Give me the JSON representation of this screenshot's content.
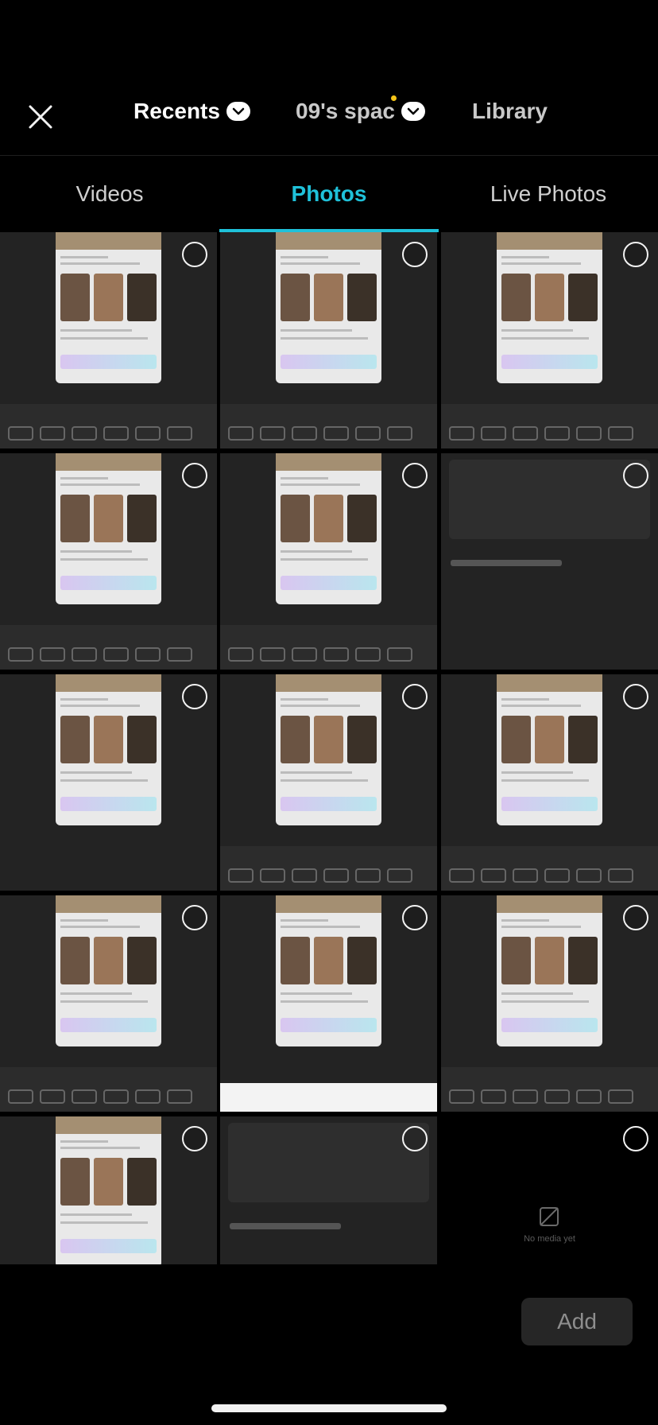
{
  "header": {
    "close_icon": "close-icon",
    "sources": [
      {
        "label": "Recents",
        "icon": "chevron-down-icon"
      },
      {
        "label": "09's spac",
        "icon": "chevron-down-icon"
      },
      {
        "label": "Library"
      }
    ]
  },
  "media_tabs": [
    {
      "label": "Videos",
      "active": false
    },
    {
      "label": "Photos",
      "active": true
    },
    {
      "label": "Live Photos",
      "active": false
    }
  ],
  "accent_color": "#1fc1d9",
  "grid": {
    "items": [
      {
        "kind": "timeline"
      },
      {
        "kind": "pattern"
      },
      {
        "kind": "pattern"
      },
      {
        "kind": "pattern"
      },
      {
        "kind": "stickers"
      },
      {
        "kind": "voiceover",
        "caption": "Select how to create voiceover"
      },
      {
        "kind": "captions",
        "caption": "To create auto captions, turn on the volume or add audio to your video."
      },
      {
        "kind": "stickers"
      },
      {
        "kind": "stickers"
      },
      {
        "kind": "text"
      },
      {
        "kind": "keyboard"
      },
      {
        "kind": "timeline"
      },
      {
        "kind": "plain"
      },
      {
        "kind": "voiceover",
        "caption": "Select how to create voiceover"
      },
      {
        "kind": "empty",
        "caption": "No media yet"
      }
    ]
  },
  "footer": {
    "add_label": "Add"
  }
}
